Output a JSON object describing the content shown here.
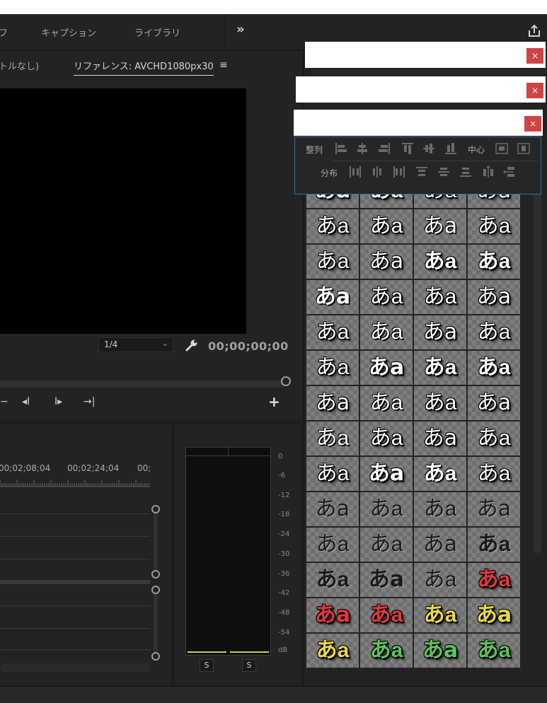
{
  "workspace": {
    "tabs": [
      "フ",
      "キャプション",
      "ライブラリ"
    ],
    "more": "»"
  },
  "monitor": {
    "tab_left": "トルなし)",
    "tab_right": "リファレンス: AVCHD1080px30",
    "menu": "≡",
    "zoom": "1/4",
    "timecode": "00;00;00;00",
    "transport": [
      "−",
      "◂I",
      "I▸",
      "→|"
    ],
    "add": "+"
  },
  "timeline": {
    "times": [
      "00;02;08;04",
      "00;02;24;04",
      "00;"
    ]
  },
  "meter": {
    "ticks": [
      "0",
      "-6",
      "-12",
      "-18",
      "-24",
      "-30",
      "-36",
      "-42",
      "-48",
      "-54",
      "dB"
    ],
    "solo": [
      "S",
      "S"
    ]
  },
  "align": {
    "align_label": "整列",
    "center_label": "中心",
    "distribute_label": "分布"
  },
  "popups": {
    "close": "×"
  },
  "styles": {
    "sample_text": "あa",
    "rows": [
      [
        {
          "c": "#ffffff",
          "s": "sh",
          "w": "b"
        },
        {
          "c": "#ffffff",
          "s": "sh",
          "w": "b"
        },
        {
          "c": "#ffffff",
          "s": "sh",
          "w": "n"
        },
        {
          "c": "#ffffff",
          "s": "sh",
          "w": "n"
        }
      ],
      [
        {
          "c": "#ffffff",
          "s": "sh",
          "w": "n"
        },
        {
          "c": "#ffffff",
          "s": "sh",
          "w": "n"
        },
        {
          "c": "#ffffff",
          "s": "ol",
          "w": "n"
        },
        {
          "c": "#ffffff",
          "s": "sh",
          "w": "n"
        }
      ],
      [
        {
          "c": "#ffffff",
          "s": "sh",
          "w": "n"
        },
        {
          "c": "#ffffff",
          "s": "sh",
          "w": "n"
        },
        {
          "c": "#ffffff",
          "s": "sh",
          "w": "b"
        },
        {
          "c": "#ffffff",
          "s": "sh",
          "w": "b"
        }
      ],
      [
        {
          "c": "#ffffff",
          "s": "ol",
          "w": "b"
        },
        {
          "c": "#ffffff",
          "s": "sh",
          "w": "n"
        },
        {
          "c": "#ffffff",
          "s": "sh",
          "w": "n"
        },
        {
          "c": "#ffffff",
          "s": "sh",
          "w": "n"
        }
      ],
      [
        {
          "c": "#ffffff",
          "s": "sh",
          "w": "n"
        },
        {
          "c": "#ffffff",
          "s": "ol",
          "w": "n"
        },
        {
          "c": "#ffffff",
          "s": "sh",
          "w": "n"
        },
        {
          "c": "#ffffff",
          "s": "sh",
          "w": "n"
        }
      ],
      [
        {
          "c": "#ffffff",
          "s": "sh",
          "w": "n"
        },
        {
          "c": "#ffffff",
          "s": "sh",
          "w": "b"
        },
        {
          "c": "#ffffff",
          "s": "sh",
          "w": "b"
        },
        {
          "c": "#ffffff",
          "s": "sh",
          "w": "b"
        }
      ],
      [
        {
          "c": "#ffffff",
          "s": "sh",
          "w": "n"
        },
        {
          "c": "#ffffff",
          "s": "ol",
          "w": "n"
        },
        {
          "c": "#ffffff",
          "s": "sh",
          "w": "n"
        },
        {
          "c": "#ffffff",
          "s": "sh",
          "w": "n"
        }
      ],
      [
        {
          "c": "#ffffff",
          "s": "ol",
          "w": "n"
        },
        {
          "c": "#ffffff",
          "s": "sh",
          "w": "n"
        },
        {
          "c": "#ffffff",
          "s": "sh",
          "w": "n"
        },
        {
          "c": "#ffffff",
          "s": "sh",
          "w": "n"
        }
      ],
      [
        {
          "c": "#ffffff",
          "s": "sh",
          "w": "n"
        },
        {
          "c": "#ffffff",
          "s": "sh",
          "w": "b"
        },
        {
          "c": "#ffffff",
          "s": "ol",
          "w": "b"
        },
        {
          "c": "#ffffff",
          "s": "sh",
          "w": "n"
        }
      ],
      [
        {
          "c": "#1a1a1a",
          "s": "lt",
          "w": "n"
        },
        {
          "c": "#1a1a1a",
          "s": "lt",
          "w": "n"
        },
        {
          "c": "#1a1a1a",
          "s": "lt",
          "w": "n"
        },
        {
          "c": "#1a1a1a",
          "s": "lt",
          "w": "n"
        }
      ],
      [
        {
          "c": "#1a1a1a",
          "s": "lt",
          "w": "n"
        },
        {
          "c": "#1a1a1a",
          "s": "lt",
          "w": "n"
        },
        {
          "c": "#1a1a1a",
          "s": "lt",
          "w": "n"
        },
        {
          "c": "#1a1a1a",
          "s": "lt",
          "w": "b"
        }
      ],
      [
        {
          "c": "#1a1a1a",
          "s": "lt",
          "w": "b"
        },
        {
          "c": "#1a1a1a",
          "s": "lt",
          "w": "b"
        },
        {
          "c": "#1a1a1a",
          "s": "lt",
          "w": "n"
        },
        {
          "c": "#e03a3a",
          "s": "sh",
          "w": "b"
        }
      ],
      [
        {
          "c": "#e03a3a",
          "s": "sh",
          "w": "b"
        },
        {
          "c": "#e03a3a",
          "s": "sh",
          "w": "b"
        },
        {
          "c": "#e8d84a",
          "s": "sh",
          "w": "b"
        },
        {
          "c": "#e8d84a",
          "s": "sh",
          "w": "b"
        }
      ],
      [
        {
          "c": "#e8d84a",
          "s": "sh",
          "w": "b"
        },
        {
          "c": "#5ec25e",
          "s": "sh",
          "w": "b"
        },
        {
          "c": "#5ec25e",
          "s": "sh",
          "w": "b"
        },
        {
          "c": "#5ec25e",
          "s": "sh",
          "w": "b"
        }
      ]
    ]
  }
}
